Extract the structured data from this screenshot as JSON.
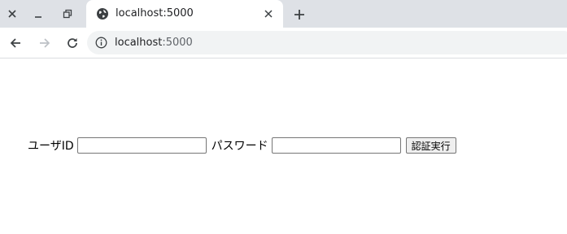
{
  "browser": {
    "tab": {
      "title": "localhost:5000",
      "favicon": "globe-icon",
      "close_icon": "close-icon"
    },
    "new_tab_icon": "plus-icon",
    "window_controls": [
      "close-icon",
      "minimize-icon",
      "restore-icon"
    ],
    "nav": [
      "back-arrow-icon",
      "forward-arrow-icon",
      "reload-icon"
    ],
    "address": {
      "info_icon": "info-icon",
      "host": "localhost",
      "port": ":5000"
    }
  },
  "form": {
    "user_id_label": "ユーザID",
    "user_id_value": "",
    "password_label": "パスワード",
    "password_value": "",
    "submit_label": "認証実行"
  },
  "colors": {
    "tabbar_bg": "#dee1e6",
    "omnibox_bg": "#f1f3f4",
    "forward_disabled": "#bdc1c6"
  }
}
